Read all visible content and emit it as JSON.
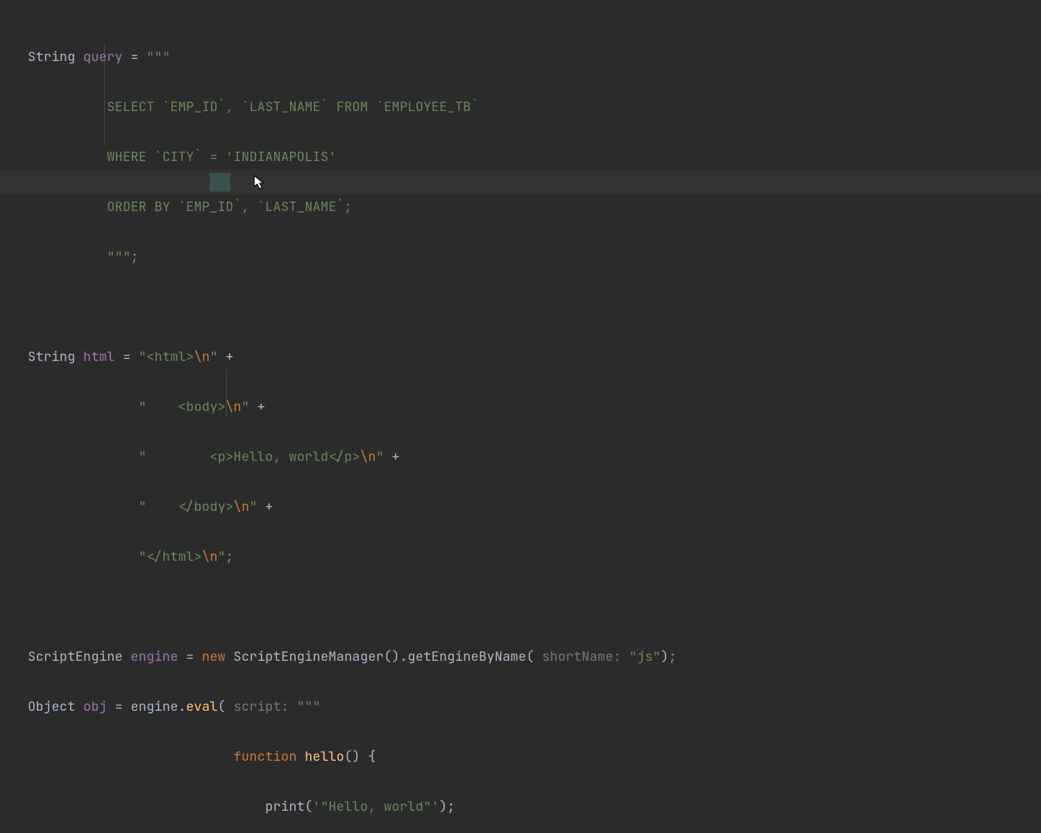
{
  "line1_type": "String ",
  "line1_var": "query",
  "line1_op": " = ",
  "line1_str": "\"\"\"",
  "line2_str": "SELECT `EMP_ID`, `LAST_NAME` FROM `EMPLOYEE_TB`",
  "line3_str": "WHERE `CITY` = 'INDIANAPOLIS'",
  "line4_str": "ORDER BY `EMP_ID`, `LAST_NAME`;",
  "line5_str": "\"\"\"",
  "line5_semi": ";",
  "line7_type": "String ",
  "line7_var": "html",
  "line7_op": " = ",
  "line7_sa": "\"<html>",
  "line7_esc": "\\n",
  "line7_sb": "\"",
  "line7_plus": " +",
  "line8_sa": "\"    <body>",
  "line8_esc": "\\n",
  "line8_sb": "\"",
  "line8_plus": " +",
  "line9_sa": "\"        <p>Hello, world</p>",
  "line9_esc": "\\n",
  "line9_sb": "\"",
  "line9_plus": " +",
  "line10_sa": "\"    </body>",
  "line10_esc": "\\n",
  "line10_sb": "\"",
  "line10_plus": " +",
  "line11_sa": "\"</html>",
  "line11_esc": "\\n",
  "line11_sb": "\"",
  "line11_semi": ";",
  "line13_type": "ScriptEngine ",
  "line13_var": "engine",
  "line13_op": " = ",
  "line13_kw": "new ",
  "line13_call1": "ScriptEngineManager().getEngineByName(",
  "line13_hint": " shortName: ",
  "line13_arg": "\"js\"",
  "line13_close": ")",
  "line13_semi": ";",
  "line14_type": "Object ",
  "line14_var": "obj",
  "line14_op": " = ",
  "line14_recv": "engine.",
  "line14_meth": "eval",
  "line14_open": "(",
  "line14_hint": " script: ",
  "line14_str": "\"\"\"",
  "line15a": "function ",
  "line15b": "hello",
  "line15c": "() {",
  "line16a": "print(",
  "line16b": "'\"Hello, world\"'",
  "line16c": ");"
}
